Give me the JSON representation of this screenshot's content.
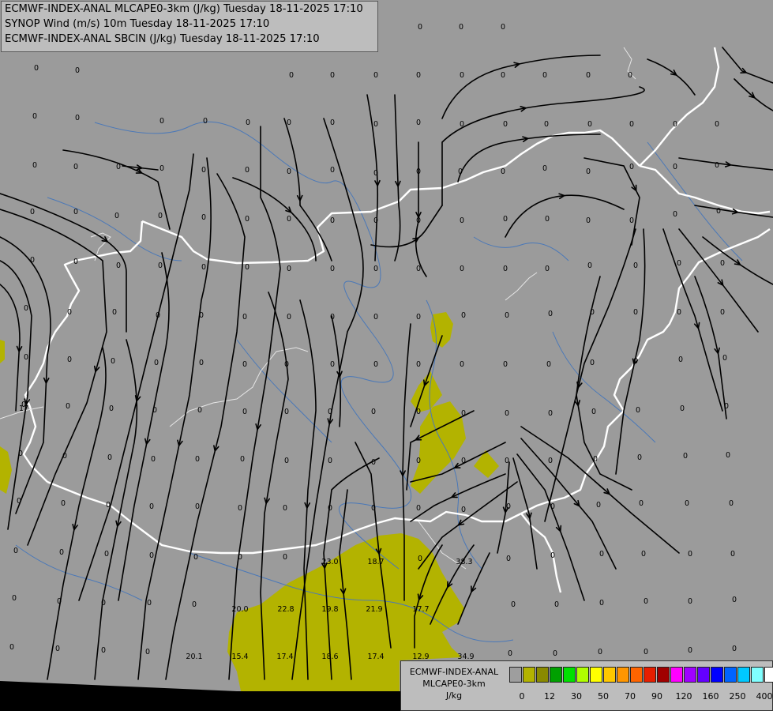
{
  "header": {
    "line1": "ECMWF-INDEX-ANAL MLCAPE0-3km (J/kg) Tuesday 18-11-2025 17:10",
    "line2": "SYNOP Wind (m/s) 10m Tuesday 18-11-2025 17:10",
    "line3": "ECMWF-INDEX-ANAL SBCIN (J/kg) Tuesday 18-11-2025 17:10"
  },
  "colors": {
    "background": "#9b9b9b",
    "cape_fill": "#b3b300",
    "border": "#ffffff",
    "rivers": "#4a78b8",
    "streamlines": "#000000"
  },
  "legend": {
    "title1": "ECMWF-INDEX-ANAL",
    "title2": "MLCAPE0-3km",
    "unit": "J/kg",
    "swatches": [
      "#9e9e9e",
      "#b3b300",
      "#8a8a00",
      "#00a000",
      "#00e000",
      "#b0ff00",
      "#ffff00",
      "#ffc800",
      "#ff9600",
      "#ff6400",
      "#e61e00",
      "#a00000",
      "#ff00ff",
      "#a000ff",
      "#6400ff",
      "#0000ff",
      "#0064ff",
      "#00c8ff",
      "#80ffff",
      "#ffffff"
    ],
    "ticks": [
      "0",
      "12",
      "30",
      "50",
      "70",
      "90",
      "120",
      "160",
      "250",
      "400"
    ]
  },
  "zero_label": "0",
  "cape_labels": [
    "23.0",
    "18.7",
    "38.3",
    "20.0",
    "22.8",
    "19.8",
    "21.9",
    "17.7",
    "20.1",
    "15.4",
    "17.4",
    "18.6",
    "17.4",
    "12.9",
    "34.9",
    "17"
  ]
}
